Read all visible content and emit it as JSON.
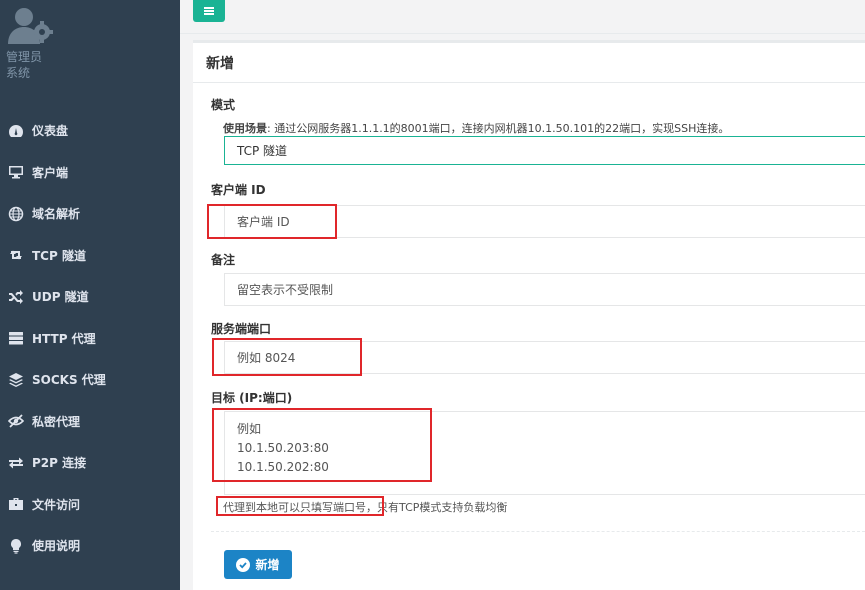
{
  "sidebar": {
    "profile_name": "管理员",
    "profile_role": "系统",
    "items": [
      {
        "label": "仪表盘",
        "icon": "dashboard-icon"
      },
      {
        "label": "客户端",
        "icon": "monitor-icon"
      },
      {
        "label": "域名解析",
        "icon": "globe-icon"
      },
      {
        "label": "TCP 隧道",
        "icon": "retweet-icon"
      },
      {
        "label": "UDP 隧道",
        "icon": "shuffle-icon"
      },
      {
        "label": "HTTP 代理",
        "icon": "server-icon"
      },
      {
        "label": "SOCKS 代理",
        "icon": "layers-icon"
      },
      {
        "label": "私密代理",
        "icon": "eye-slash-icon"
      },
      {
        "label": "P2P 连接",
        "icon": "exchange-icon"
      },
      {
        "label": "文件访问",
        "icon": "briefcase-icon"
      },
      {
        "label": "使用说明",
        "icon": "lightbulb-icon"
      }
    ]
  },
  "panel": {
    "title": "新增",
    "mode_label": "模式",
    "scenario_label": "使用场景",
    "scenario_text": ": 通过公网服务器1.1.1.1的8001端口，连接内网机器10.1.50.101的22端口，实现SSH连接。",
    "mode_value": "TCP 隧道",
    "client_id_label": "客户端 ID",
    "client_id_placeholder": "客户端 ID",
    "remark_label": "备注",
    "remark_placeholder": "留空表示不受限制",
    "server_port_label": "服务端端口",
    "server_port_placeholder": "例如 8024",
    "target_label": "目标 (IP:端口)",
    "target_placeholder_line1": "例如",
    "target_placeholder_line2": "10.1.50.203:80",
    "target_placeholder_line3": "10.1.50.202:80",
    "help_text_highlight": "代理到本地可以只填写端口号",
    "help_text_rest": "，只有TCP模式支持负载均衡",
    "submit_label": "新增"
  },
  "colors": {
    "sidebar_bg": "#2f4050",
    "accent_green": "#1ab394",
    "primary_blue": "#1c84c6",
    "annotation_red": "#e0262a"
  }
}
